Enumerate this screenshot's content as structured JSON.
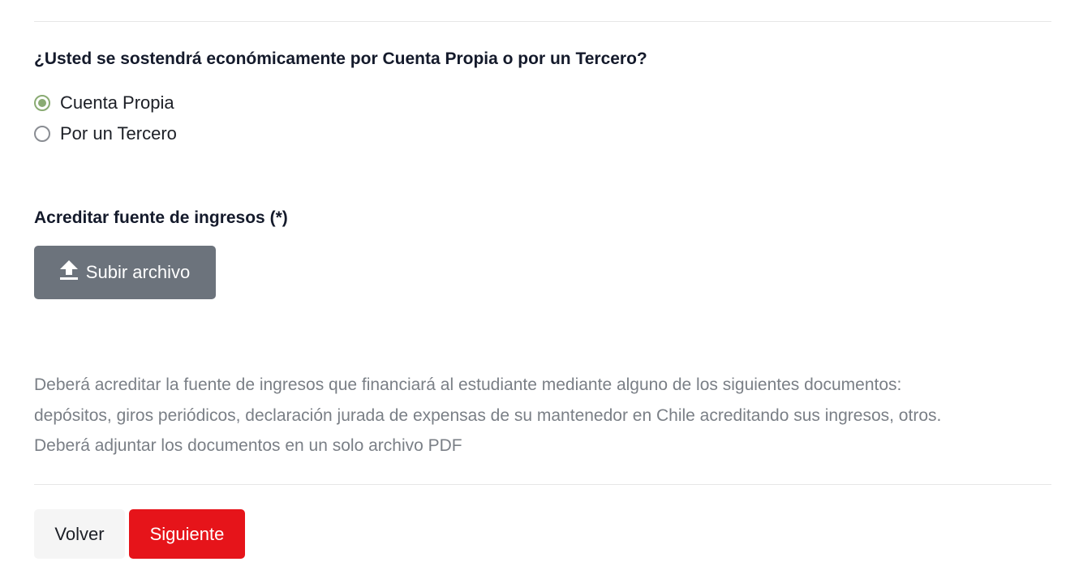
{
  "question": {
    "text": "¿Usted se sostendrá económicamente por Cuenta Propia o por un Tercero?",
    "options": [
      {
        "label": "Cuenta Propia",
        "selected": true
      },
      {
        "label": "Por un Tercero",
        "selected": false
      }
    ],
    "accent_color": "#8aab73"
  },
  "upload": {
    "title": "Acreditar fuente de ingresos (*)",
    "button_label": "Subir archivo",
    "icon": "upload-icon"
  },
  "help": {
    "line1": "Deberá acreditar la fuente de ingresos que financiará al estudiante mediante alguno de los siguientes documentos:",
    "line2": "depósitos, giros periódicos, declaración jurada de expensas de su mantenedor en Chile acreditando sus ingresos, otros.",
    "line3": "Deberá adjuntar los documentos en un solo archivo PDF"
  },
  "nav": {
    "back_label": "Volver",
    "next_label": "Siguiente",
    "next_color": "#e6141a"
  }
}
